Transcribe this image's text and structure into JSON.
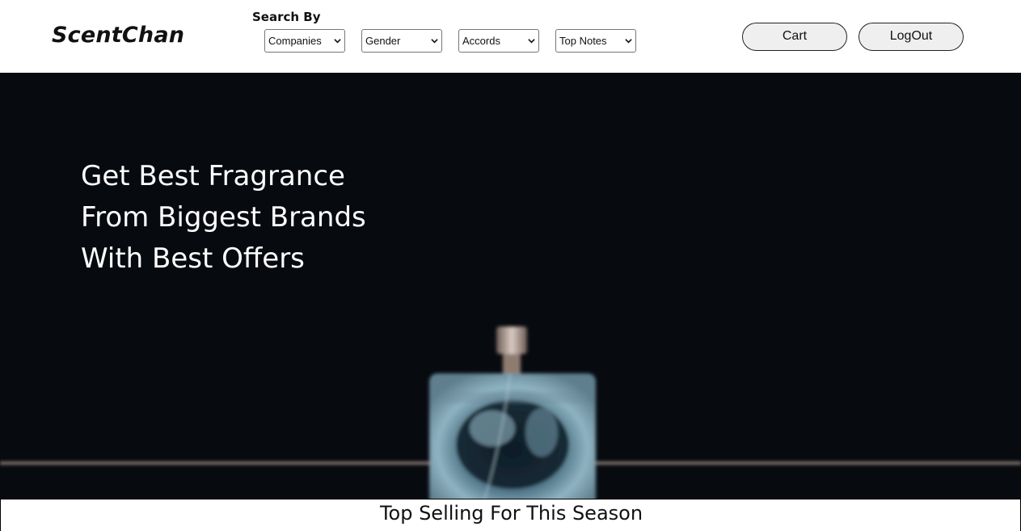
{
  "header": {
    "logo": "ScentChan",
    "search_label": "Search By",
    "filters": [
      {
        "selected": "Companies"
      },
      {
        "selected": "Gender"
      },
      {
        "selected": "Accords"
      },
      {
        "selected": "Top Notes"
      }
    ],
    "cart_label": "Cart",
    "logout_label": "LogOut"
  },
  "hero": {
    "headline_lines": [
      "Get Best Fragrance",
      "From Biggest Brands",
      "With Best Offers"
    ]
  },
  "section": {
    "title": "Top Selling For This Season"
  },
  "colors": {
    "hero_background": "#070b10",
    "button_background": "#efefef"
  },
  "icons": [
    "chevron-down-icon"
  ]
}
